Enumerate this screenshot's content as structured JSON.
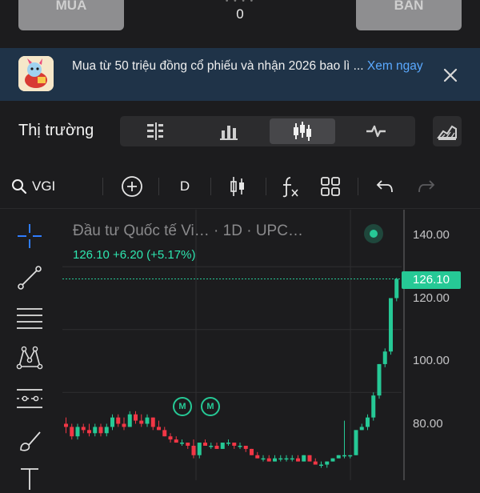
{
  "trade": {
    "buy_label": "MUA",
    "sell_label": "BÁN",
    "quantity": "0"
  },
  "banner": {
    "text": "Mua từ 50 triệu đồng cổ phiếu và nhận 2026 bao lì ...",
    "more": "Xem ngay"
  },
  "market": {
    "title": "Thị trường",
    "tabs": [
      "order-book-icon",
      "bar-chart-icon",
      "candlestick-icon",
      "line-pulse-icon"
    ],
    "active_tab": 2
  },
  "toolbar": {
    "symbol": "VGI",
    "interval": "D"
  },
  "chart": {
    "legend_name": "Đầu tư Quốc tế Vi… · 1D · UPC…",
    "legend_price": "126.10 +6.20 (+5.17%)",
    "last_price_label": "126.10",
    "markers": [
      "M",
      "M"
    ],
    "colors": {
      "up": "#26c996",
      "down": "#f23645",
      "background": "#1c1c1e"
    }
  },
  "chart_data": {
    "type": "candlestick",
    "y_tick_labels": [
      "140.00",
      "120.00",
      "100.00",
      "80.00"
    ],
    "y_ticks": [
      140,
      120,
      100,
      80
    ],
    "last_price": 126.1,
    "ohlc": [
      [
        80,
        82,
        77,
        79
      ],
      [
        79,
        80,
        75,
        76
      ],
      [
        76,
        80,
        75,
        79
      ],
      [
        79,
        80,
        77,
        78
      ],
      [
        78,
        80,
        76,
        77
      ],
      [
        77,
        80,
        76,
        79
      ],
      [
        79,
        80,
        76,
        77
      ],
      [
        77,
        80,
        76,
        79
      ],
      [
        79,
        83,
        78,
        82
      ],
      [
        82,
        83,
        79,
        80
      ],
      [
        80,
        82,
        78,
        79
      ],
      [
        79,
        84,
        79,
        83
      ],
      [
        83,
        84,
        80,
        81
      ],
      [
        81,
        83,
        79,
        80
      ],
      [
        80,
        83,
        79,
        82
      ],
      [
        82,
        82,
        78,
        79
      ],
      [
        79,
        81,
        78,
        78
      ],
      [
        78,
        79,
        76,
        76
      ],
      [
        76,
        77,
        74,
        75
      ],
      [
        75,
        76,
        74,
        74
      ],
      [
        74,
        75,
        73,
        74
      ],
      [
        74,
        74,
        72,
        73
      ],
      [
        73,
        75,
        69,
        70
      ],
      [
        70,
        74,
        69,
        74
      ],
      [
        74,
        75,
        73,
        73
      ],
      [
        73,
        74,
        72,
        73
      ],
      [
        73,
        74,
        72,
        72
      ],
      [
        72,
        74,
        72,
        74
      ],
      [
        74,
        75,
        73,
        74
      ],
      [
        74,
        74,
        72,
        73
      ],
      [
        73,
        74,
        72,
        73
      ],
      [
        73,
        73,
        71,
        72
      ],
      [
        72,
        72,
        70,
        70
      ],
      [
        70,
        71,
        69,
        69
      ],
      [
        69,
        70,
        68,
        69
      ],
      [
        69,
        70,
        68,
        68
      ],
      [
        68,
        70,
        68,
        69
      ],
      [
        69,
        70,
        68,
        69
      ],
      [
        69,
        70,
        68,
        69
      ],
      [
        69,
        70,
        68,
        69
      ],
      [
        69,
        70,
        68,
        68
      ],
      [
        68,
        70,
        68,
        70
      ],
      [
        70,
        70,
        68,
        68
      ],
      [
        68,
        69,
        67,
        67
      ],
      [
        67,
        68,
        66,
        67
      ],
      [
        67,
        68,
        66,
        68
      ],
      [
        68,
        69,
        68,
        69
      ],
      [
        69,
        70,
        69,
        70
      ],
      [
        70,
        81,
        69,
        70
      ],
      [
        70,
        70,
        69,
        70
      ],
      [
        70,
        78,
        70,
        78
      ],
      [
        78,
        80,
        78,
        79
      ],
      [
        79,
        83,
        78,
        82
      ],
      [
        82,
        90,
        81,
        89
      ],
      [
        89,
        99,
        88,
        99
      ],
      [
        99,
        104,
        98,
        103
      ],
      [
        103,
        120,
        102,
        120
      ],
      [
        120,
        126.5,
        119,
        126.1
      ]
    ]
  }
}
